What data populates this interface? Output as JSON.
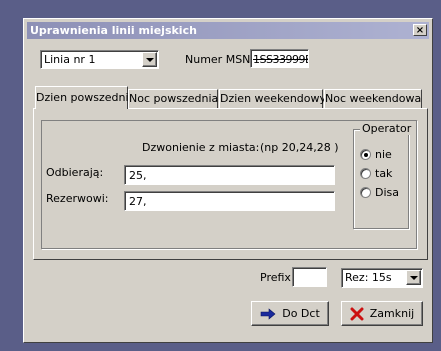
{
  "window": {
    "title": "Uprawnienia linii miejskich",
    "close_glyph": "×"
  },
  "top": {
    "line_select_value": "Linia nr 1",
    "msn_label": "Numer MSN",
    "msn_value": "1SS33999E"
  },
  "tabs": [
    {
      "label": "Dzien powszedni",
      "active": true
    },
    {
      "label": "Noc powszednia",
      "active": false
    },
    {
      "label": "Dzien weekendowy",
      "active": false
    },
    {
      "label": "Noc weekendowa",
      "active": false
    }
  ],
  "panel": {
    "dialing_label": "Dzwonienie z miasta:",
    "dialing_hint": "(np 20,24,28 )",
    "receivers_label": "Odbierają:",
    "receivers_value": "25,",
    "reserves_label": "Rezerwowi:",
    "reserves_value": "27,",
    "operator": {
      "legend": "Operator",
      "options": [
        {
          "label": "nie",
          "checked": true
        },
        {
          "label": "tak",
          "checked": false
        },
        {
          "label": "Disa",
          "checked": false
        }
      ]
    }
  },
  "bottom": {
    "prefix_label": "Prefix:",
    "prefix_value": "",
    "rez_select_value": "Rez: 15s",
    "do_dct_label": "Do Dct",
    "close_label": "Zamknij"
  },
  "colors": {
    "desktop": "#5a5e88",
    "face": "#d4d0c8",
    "title_start": "#8d90b6",
    "title_end": "#aeb2d2",
    "arrow_icon": "#1a2a9c",
    "x_icon": "#cc1111"
  },
  "icons": {
    "do_dct": "right-arrow-icon",
    "close": "red-x-icon",
    "combo": "chevron-down-icon"
  }
}
